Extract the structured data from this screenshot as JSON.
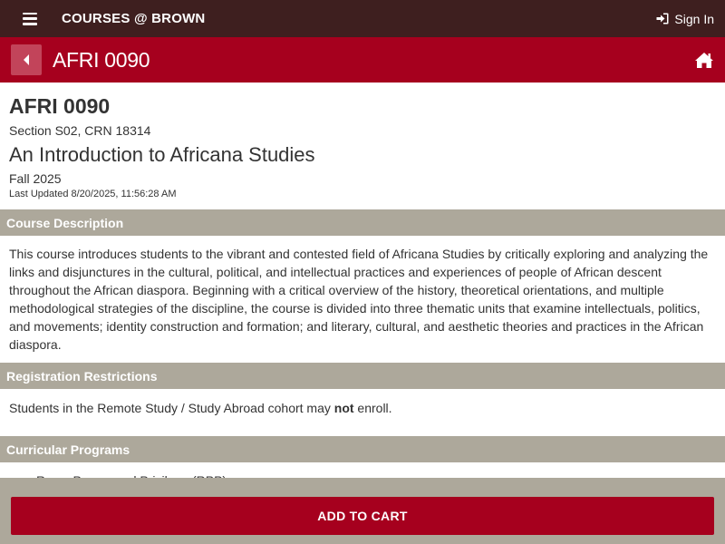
{
  "topbar": {
    "menu_icon": "hamburger-icon",
    "brand": "COURSES @ BROWN",
    "signin_icon": "sign-in-icon",
    "signin_label": "Sign In"
  },
  "header": {
    "back_icon": "caret-left-icon",
    "title": "AFRI 0090",
    "home_icon": "home-icon"
  },
  "course": {
    "code": "AFRI 0090",
    "section_crn": "Section S02, CRN 18314",
    "title": "An Introduction to Africana Studies",
    "term": "Fall 2025",
    "last_updated": "Last Updated 8/20/2025, 11:56:28 AM"
  },
  "description": {
    "heading": "Course Description",
    "text": "This course introduces students to the vibrant and contested field of Africana Studies by critically exploring and analyzing the links and disjunctures in the cultural, political, and intellectual practices and experiences of people of African descent throughout the African diaspora. Beginning with a critical overview of the history, theoretical orientations, and multiple methodological strategies of the discipline, the course is divided into three thematic units that examine intellectuals, politics, and movements; identity construction and formation; and literary, cultural, and aesthetic theories and practices in the African diaspora."
  },
  "restrictions": {
    "heading": "Registration Restrictions",
    "text_before": "Students in the Remote Study / Study Abroad cohort may ",
    "text_bold": "not",
    "text_after": " enroll."
  },
  "programs": {
    "heading": "Curricular Programs",
    "items": [
      "Race, Power, and Privilege (RPP)"
    ]
  },
  "cart": {
    "label": "ADD TO CART"
  },
  "colors": {
    "topbar": "#3e1f1f",
    "brand_red": "#a6001e",
    "section_header": "#ada89b"
  }
}
